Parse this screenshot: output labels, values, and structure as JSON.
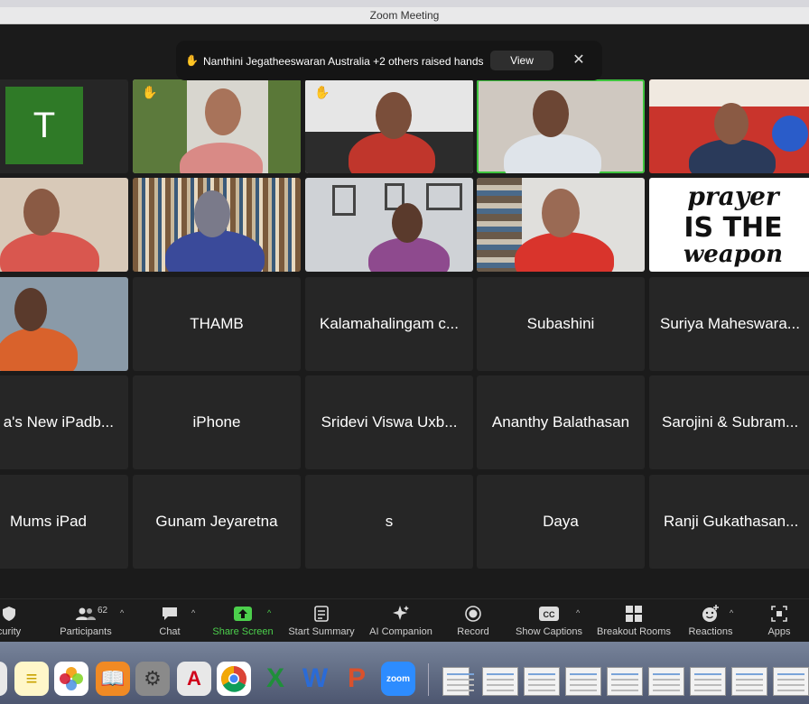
{
  "window": {
    "title": "Zoom Meeting"
  },
  "banner": {
    "message": "Nanthini Jegatheeswaran Australia +2 others raised hands",
    "view_label": "View"
  },
  "avatar_letter": "T",
  "tiles": {
    "r3c2": "THAMB",
    "r3c3": "Kalamahalingam c...",
    "r3c4": "Subashini",
    "r3c5": "Suriya Maheswara...",
    "r4c1": "a's New iPadb...",
    "r4c2": "iPhone",
    "r4c3": "Sridevi Viswa Uxb...",
    "r4c4": "Ananthy Balathasan",
    "r4c5": "Sarojini & Subram...",
    "r5c1": "Mums iPad",
    "r5c2": "Gunam Jeyaretna",
    "r5c3": "s",
    "r5c4": "Daya",
    "r5c5": "Ranji Gukathasan..."
  },
  "toolbar": {
    "security": "curity",
    "participants": "Participants",
    "participants_count": "62",
    "chat": "Chat",
    "share_screen": "Share Screen",
    "start_summary": "Start Summary",
    "ai_companion": "AI Companion",
    "record": "Record",
    "show_captions": "Show Captions",
    "breakout_rooms": "Breakout Rooms",
    "reactions": "Reactions",
    "apps": "Apps"
  },
  "poster_text": {
    "line1": "prayer",
    "line2": "IS THE",
    "line3": "weapon"
  },
  "dock": {
    "zoom_label": "zoom"
  },
  "colors": {
    "accent_green": "#3ec43e",
    "share_green": "#4ccf4c",
    "avatar_green": "#2f7a27"
  }
}
